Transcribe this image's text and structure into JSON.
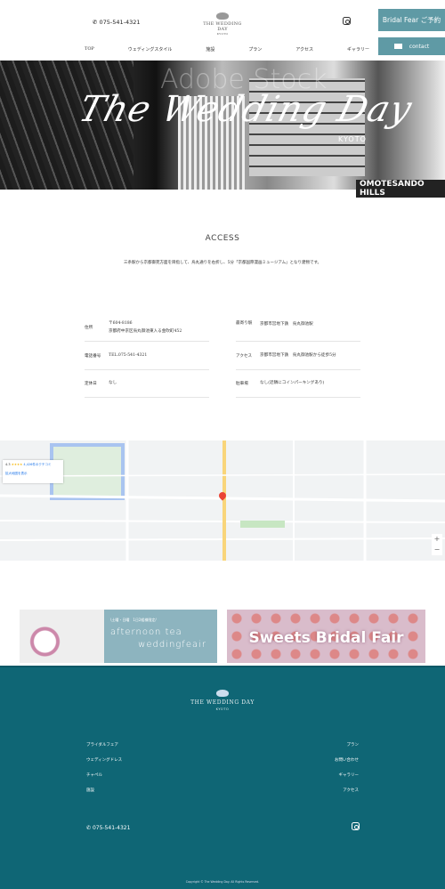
{
  "header": {
    "tel": "075-541-4321",
    "logo": "THE WEDDING DAY",
    "logo_sub": "KYOTO",
    "bridal_fair_button": "Bridal Fear ご予約",
    "contact_button": "contact",
    "nav": [
      "TOP",
      "ウェディングスタイル",
      "施設",
      "プラン",
      "アクセス",
      "ギャラリー"
    ]
  },
  "hero": {
    "script_title": "The Wedding Day",
    "sub": "KYOTO",
    "watermark": "Adobe Stock",
    "sign": "OMOTESANDO HILLS"
  },
  "access": {
    "title": "ACCESS",
    "intro": "三条駅から京都御苑方面を目指して、烏丸通りを右折し、5分「京都国際漫画ミュージアム」となり建物です。",
    "left": [
      {
        "label": "住所",
        "lines": [
          "〒604-8186",
          "京都府中京区烏丸御池東入る金吹町452"
        ]
      },
      {
        "label": "電話番号",
        "lines": [
          "TEL.075-541-4321"
        ]
      },
      {
        "label": "定休日",
        "lines": [
          "なし"
        ]
      }
    ],
    "right": [
      {
        "label": "最寄り駅",
        "lines": [
          "京都市営地下鉄　烏丸御池駅"
        ]
      },
      {
        "label": "アクセス",
        "lines": [
          "京都市営地下鉄　烏丸御池駅から徒歩5分"
        ]
      },
      {
        "label": "駐車場",
        "lines": [
          "なし(近隣にコインパーキングあり)"
        ]
      }
    ]
  },
  "map": {
    "rating": "4.3",
    "stars": "★★★★",
    "reviews": "4,426件のクチコミ",
    "enlarge_link": "拡大地図を表示",
    "zoom_in": "+",
    "zoom_out": "−"
  },
  "banners": [
    {
      "tag": "\\土曜・日曜　1日2組様限定/",
      "line1": "afternoon tea",
      "line2": "weddingfeair"
    },
    {
      "title": "Sweets Bridal Fair"
    }
  ],
  "footer": {
    "logo": "THE WEDDING DAY",
    "logo_sub": "KYOTO",
    "left_links": [
      "ブライダルフェア",
      "ウェディングドレス",
      "チャペル",
      "施設"
    ],
    "right_links": [
      "プラン",
      "お問い合わせ",
      "ギャラリー",
      "アクセス"
    ],
    "tel": "075-541-4321",
    "copyright": "Copyright © The Wedding Day. All Rights Reserved."
  },
  "colors": {
    "accent": "#5f9aa5",
    "footer_bg": "#0f6675"
  }
}
